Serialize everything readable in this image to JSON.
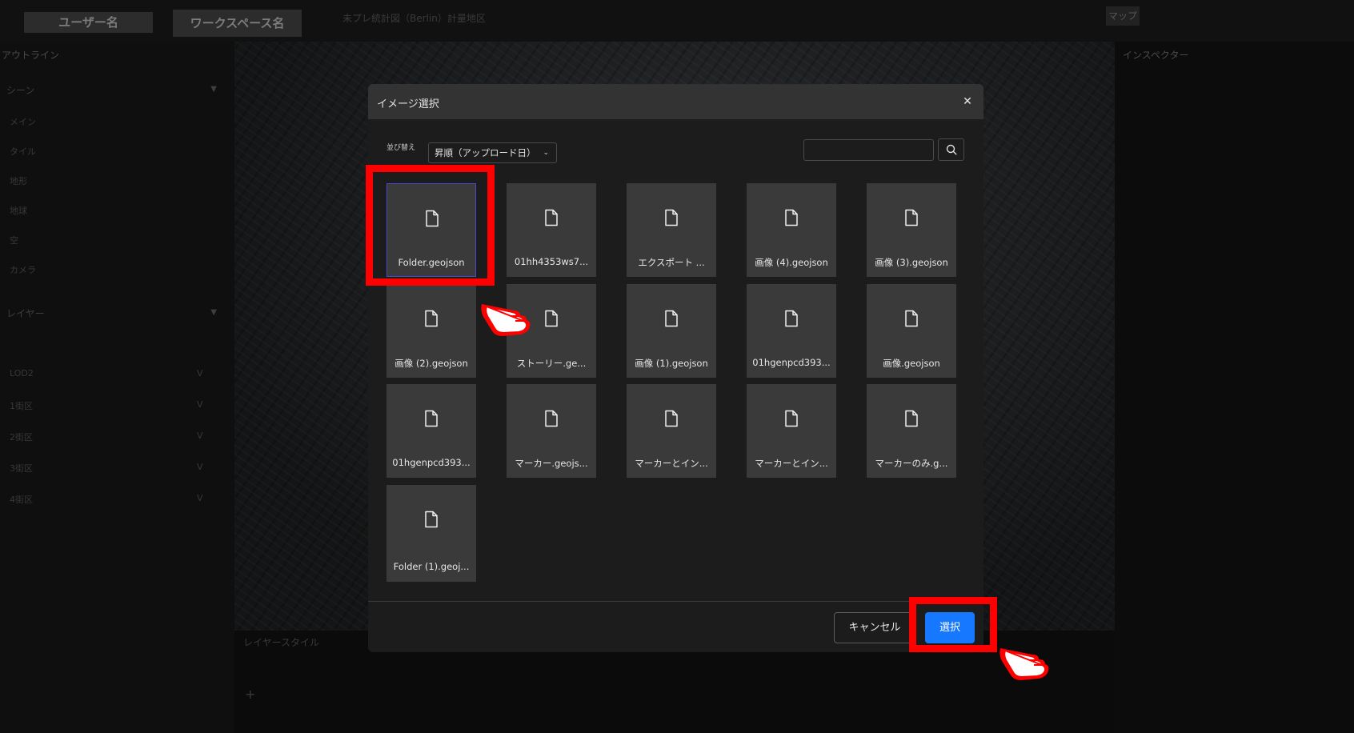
{
  "app": {
    "user_name": "ユーザー名",
    "workspace_name": "ワークスペース名",
    "project_title": "未プレ統計図（Berlin）計量地区",
    "map_tab": "マップ",
    "outline_title": "アウトライン",
    "scene_section": "シーン",
    "scene_items": [
      "メイン",
      "タイル",
      "地形",
      "地球",
      "空",
      "カメラ"
    ],
    "layer_section": "レイヤー",
    "layer_items": [
      "LOD2",
      "1街区",
      "2街区",
      "3街区",
      "4街区"
    ],
    "layer_style_title": "レイヤースタイル",
    "inspector_title": "インスペクター"
  },
  "modal": {
    "title": "イメージ選択",
    "close_icon": "close-icon",
    "sort_label": "並び替え",
    "sort_value": "昇順（アップロード日）",
    "search_value": "",
    "search_icon": "search-icon",
    "files": [
      {
        "name": "Folder.geojson",
        "selected": true
      },
      {
        "name": "01hh4353ws7...",
        "selected": false
      },
      {
        "name": "エクスポート ...",
        "selected": false
      },
      {
        "name": "画像 (4).geojson",
        "selected": false
      },
      {
        "name": "画像 (3).geojson",
        "selected": false
      },
      {
        "name": "画像 (2).geojson",
        "selected": false
      },
      {
        "name": "ストーリー.ge...",
        "selected": false
      },
      {
        "name": "画像 (1).geojson",
        "selected": false
      },
      {
        "name": "01hgenpcd393...",
        "selected": false
      },
      {
        "name": "画像.geojson",
        "selected": false
      },
      {
        "name": "01hgenpcd393...",
        "selected": false
      },
      {
        "name": "マーカー.geojs...",
        "selected": false
      },
      {
        "name": "マーカーとイン...",
        "selected": false
      },
      {
        "name": "マーカーとイン...",
        "selected": false
      },
      {
        "name": "マーカーのみ.g...",
        "selected": false
      },
      {
        "name": "Folder (1).geoj...",
        "selected": false
      }
    ],
    "cancel_label": "キャンセル",
    "select_label": "選択"
  },
  "colors": {
    "accent": "#1677ff",
    "highlight": "#ff0000",
    "selected_border": "#4b49c8"
  }
}
